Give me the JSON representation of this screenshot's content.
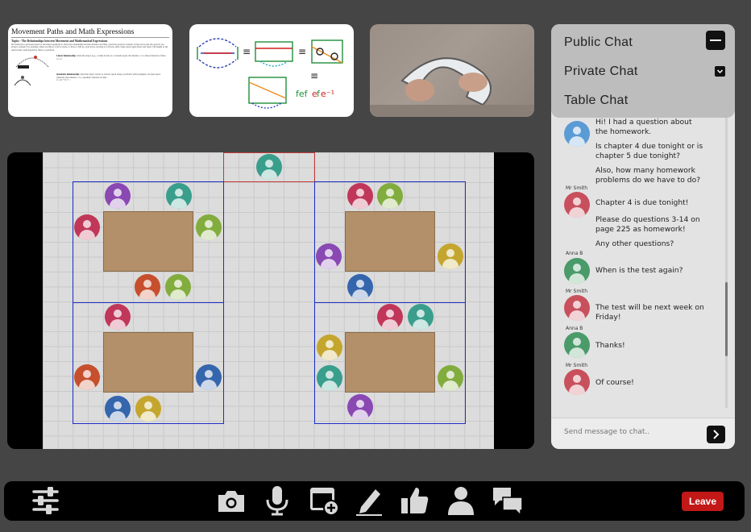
{
  "thumbnails": {
    "doc": {
      "title": "Movement Paths and Math Expressions",
      "subtitle": "Topics - The Relationships between Movement and Mathematical Expressions",
      "intro": "We learned in a previous lesson to use linear equations to study the relationship between distance and time, given the speed in constant. In the real world, the speed is not always constant. For example, when you throw a ball or stone, or throw a ball up, your move, slowing as it travels, then comes down again faster and faster. The height of the object itself could depend by time to a parabola.",
      "linear_label": "Linear Relationship",
      "linear_text": ": when the object (e.g., a train) travels at a constant speed, the distance = is a linear function of time :",
      "formula1": "d = vt",
      "quad_label": "Quadratic Relationship",
      "quad_text": ": when the object travels at various speed along a parabolic path (examples, an open-space solutions, like distance = is a quadratic function of time :",
      "formula2": "d = at² + bt + c"
    }
  },
  "chat": {
    "tabs": {
      "public": "Public Chat",
      "private": "Private Chat",
      "table": "Table Chat"
    },
    "messages": [
      {
        "name": "",
        "text": "Hi! I had a question about the homework."
      },
      {
        "name": "",
        "text": "Is chapter 4 due tonight or is chapter 5 due tonight?"
      },
      {
        "name": "",
        "text": "Also, how many homework problems do we have to do?"
      },
      {
        "name": "Mr Smith",
        "text": "Chapter 4 is due tonight!"
      },
      {
        "name": "",
        "text": "Please do questions 3-14 on page 225 as homework!"
      },
      {
        "name": "",
        "text": "Any other questions?"
      },
      {
        "name": "Anna B",
        "text": "When is the test again?"
      },
      {
        "name": "Mr Smith",
        "text": "The test will be next week on Friday!"
      },
      {
        "name": "Anna B",
        "text": "Thanks!"
      },
      {
        "name": "Mr Smith",
        "text": "Of course!"
      }
    ],
    "input_placeholder": "Send message to chat..",
    "colors": {
      "teacher": "#c8505c",
      "student": "#4a9a6a",
      "self": "#5b9bd5"
    }
  },
  "toolbar": {
    "leave_label": "Leave",
    "icons": [
      "sliders-icon",
      "camera-icon",
      "microphone-icon",
      "add-content-icon",
      "pen-icon",
      "thumbs-up-icon",
      "person-icon",
      "chat-bubbles-icon"
    ]
  },
  "classroom": {
    "avatar_colors": {
      "teal": "#3a9e8c",
      "purple": "#8a48b3",
      "red": "#c0375a",
      "green": "#82ad3e",
      "orange": "#c64f2e",
      "blue": "#3566ad",
      "yellow": "#c4a62f",
      "crimson": "#c44a5a"
    }
  }
}
